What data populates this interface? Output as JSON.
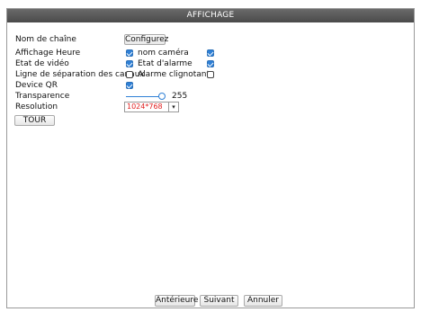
{
  "window": {
    "title": "AFFICHAGE"
  },
  "labels": {
    "channel_name": "Nom de chaîne",
    "time_display": "Affichage Heure",
    "video_state": "Etat de vidéo",
    "channel_separator": "Ligne de séparation des canaux",
    "device_qr": "Device QR",
    "transparency": "Transparence",
    "resolution": "Resolution"
  },
  "buttons": {
    "configure": "Configurez",
    "tour": "TOUR",
    "previous": "Antérieure",
    "next": "Suivant",
    "cancel": "Annuler"
  },
  "options": {
    "time_display": {
      "checked": true
    },
    "camera_name": {
      "label": "nom caméra",
      "checked": true
    },
    "video_state": {
      "checked": true
    },
    "alarm_state": {
      "label": "Etat d'alarme",
      "checked": true
    },
    "channel_separator": {
      "checked": false
    },
    "blinking_alarm": {
      "label": "Alarme clignotante",
      "checked": false
    },
    "device_qr": {
      "checked": true
    }
  },
  "transparency": {
    "value": "255",
    "fraction": 1.0
  },
  "resolution": {
    "selected": "1024*768"
  },
  "colors": {
    "accent": "#2f80d6",
    "titlebar": "#555555",
    "resolution_text": "#e02020"
  },
  "icons": {
    "dropdown": "chevron-down-icon",
    "checkbox": "checkmark-icon"
  }
}
